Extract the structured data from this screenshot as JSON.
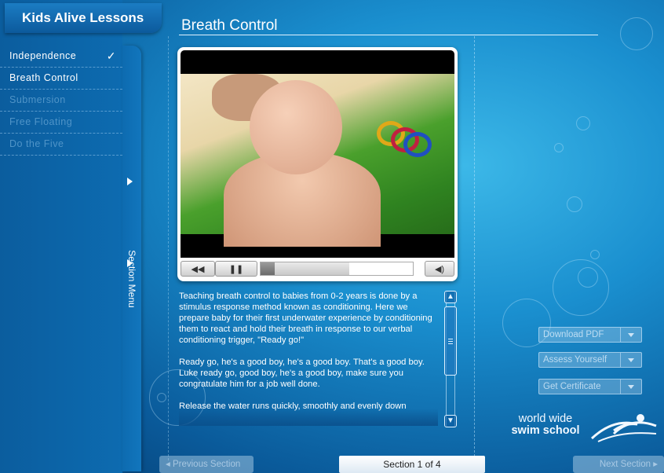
{
  "app": {
    "title": "Kids Alive Lessons"
  },
  "sidebar": {
    "items": [
      {
        "label": "Independence",
        "state": "done",
        "check": "✓"
      },
      {
        "label": "Breath Control",
        "state": "active"
      },
      {
        "label": "Submersion",
        "state": "locked"
      },
      {
        "label": "Free Floating",
        "state": "locked"
      },
      {
        "label": "Do the Five",
        "state": "locked"
      }
    ],
    "section_tab_label": "Section Menu"
  },
  "main": {
    "title": "Breath Control",
    "video": {
      "rewind_icon": "rewind-icon",
      "pause_icon": "pause-icon",
      "volume_icon": "volume-icon",
      "progress": 0.58
    },
    "transcript": {
      "p1": "Teaching breath control to babies from 0-2 years is done by a stimulus response method known as conditioning. Here we prepare baby for their first underwater experience by conditioning them to react and hold their breath in response to our verbal conditioning trigger, \"Ready go!\"",
      "p2": "Ready go, he's a good boy, he's a good boy. That's a good boy. Luke ready go, good boy, he's a good boy, make sure you congratulate him for a job well done.",
      "p3": "Release the water runs quickly, smoothly and evenly down"
    }
  },
  "right_panel": {
    "download_label": "Download PDF",
    "assess_label": "Assess Yourself",
    "certificate_label": "Get Certificate",
    "logo_line1": "world wide",
    "logo_line2": "swim school"
  },
  "footer": {
    "prev_label": "Previous Section",
    "section_indicator": "Section 1 of 4",
    "next_label": "Next Section"
  },
  "colors": {
    "accent": "#0d6bb0",
    "background": "#1a8fcf"
  }
}
